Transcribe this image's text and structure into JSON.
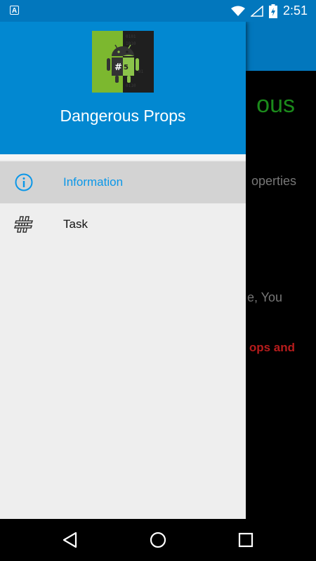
{
  "status_bar": {
    "time": "2:51",
    "notification_icon": "a-notification-icon"
  },
  "background": {
    "title_fragment": "ous",
    "line1_fragment": "operties",
    "line2_fragment": "e, You",
    "line3_fragment": "ops and"
  },
  "drawer": {
    "app_title": "Dangerous Props",
    "items": [
      {
        "label": "Information",
        "icon": "info-circle-icon",
        "selected": true
      },
      {
        "label": "Task",
        "icon": "hash-icon",
        "selected": false
      }
    ]
  },
  "colors": {
    "header_blue": "#0288d1",
    "appbar_blue": "#0277bd",
    "selected_text": "#0b97e8",
    "green_title": "#1b8a1b",
    "red_text": "#b71c1c"
  },
  "nav_bar": {
    "back": "back-icon",
    "home": "home-icon",
    "recents": "recents-icon"
  }
}
